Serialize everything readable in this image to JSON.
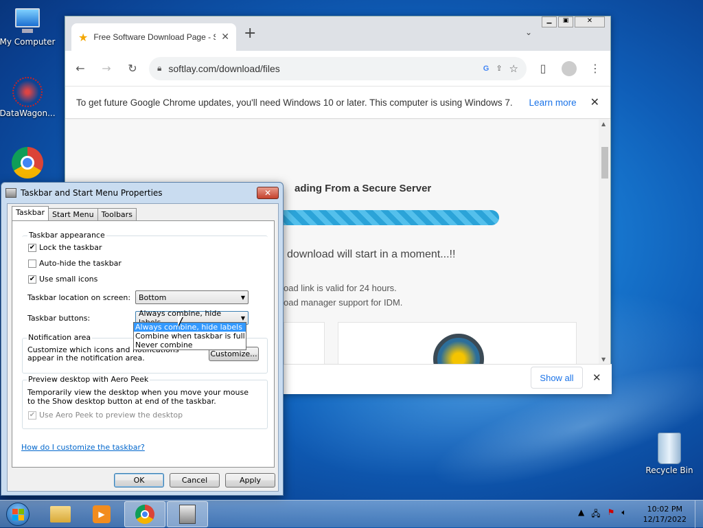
{
  "desktop": {
    "icons": [
      {
        "label": "My Computer"
      },
      {
        "label": "DataWagon..."
      },
      {
        "label": ""
      },
      {
        "label": "Recycle Bin"
      }
    ]
  },
  "browser": {
    "tab_title": "Free Software Download Page - S",
    "url": "softlay.com/download/files",
    "infobar": {
      "message": "To get future Google Chrome updates, you'll need Windows 10 or later. This computer is using Windows 7.",
      "learn_more": "Learn more"
    },
    "page": {
      "heading": "ading From a Secure Server",
      "progress": 1.0,
      "start_msg": "download will start in a moment...!!",
      "note1": "oad link is valid for 24 hours.",
      "note2": "oad manager support for IDM."
    },
    "download_bar": {
      "show_all": "Show all"
    }
  },
  "dialog": {
    "title": "Taskbar and Start Menu Properties",
    "tabs": [
      "Taskbar",
      "Start Menu",
      "Toolbars"
    ],
    "appearance": {
      "label": "Taskbar appearance",
      "lock": "Lock the taskbar",
      "lock_checked": true,
      "autohide": "Auto-hide the taskbar",
      "autohide_checked": false,
      "small_icons": "Use small icons",
      "small_icons_checked": true,
      "location_label": "Taskbar location on screen:",
      "location_value": "Bottom",
      "buttons_label": "Taskbar buttons:",
      "buttons_value": "Always combine, hide labels",
      "buttons_options": [
        "Always combine, hide labels",
        "Combine when taskbar is full",
        "Never combine"
      ]
    },
    "notification": {
      "label": "Notification area",
      "text": "Customize which icons and notifications appear in the notification area.",
      "customize": "Customize..."
    },
    "aero": {
      "label": "Preview desktop with Aero Peek",
      "text": "Temporarily view the desktop when you move your mouse to the Show desktop button at end of the taskbar.",
      "checkbox": "Use Aero Peek to preview the desktop"
    },
    "help_link": "How do I customize the taskbar?",
    "ok": "OK",
    "cancel": "Cancel",
    "apply": "Apply"
  },
  "taskbar": {
    "time": "10:02 PM",
    "date": "12/17/2022"
  },
  "colors": {
    "accent": "#1a73e8",
    "selection": "#3399ff",
    "progress": "#2ba3d8"
  }
}
